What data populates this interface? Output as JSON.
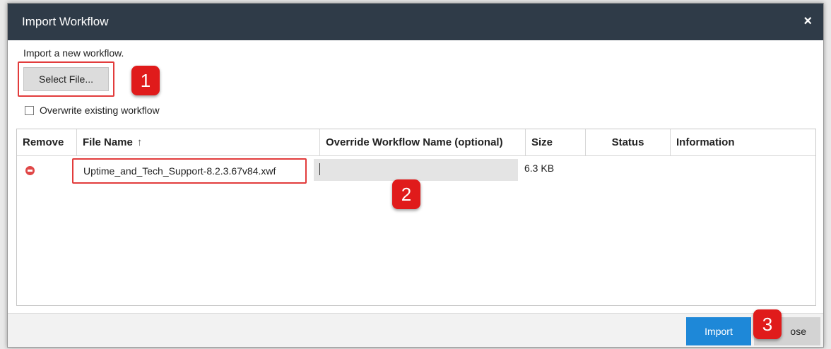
{
  "dialog": {
    "title": "Import Workflow",
    "close_icon": "×"
  },
  "intro_text": "Import a new workflow.",
  "select_file_label": "Select File...",
  "overwrite_label": "Overwrite existing workflow",
  "overwrite_checked": false,
  "grid": {
    "columns": [
      "Remove",
      "File Name",
      "Override Workflow Name (optional)",
      "Size",
      "Status",
      "Information"
    ],
    "sort_icon": "↑",
    "rows": [
      {
        "remove_icon": "remove-circle-icon",
        "file_name": "Uptime_and_Tech_Support-8.2.3.67v84.xwf",
        "override_name": "",
        "size": "6.3 KB",
        "status": "",
        "information": ""
      }
    ]
  },
  "badges": [
    "1",
    "2",
    "3"
  ],
  "footer": {
    "import_label": "Import",
    "close_label": "ose"
  },
  "colors": {
    "titlebar": "#2f3b48",
    "badge": "#e01b1b",
    "highlight_border": "#e23c3c",
    "primary_button": "#1e88d8",
    "remove_icon": "#e04848"
  }
}
